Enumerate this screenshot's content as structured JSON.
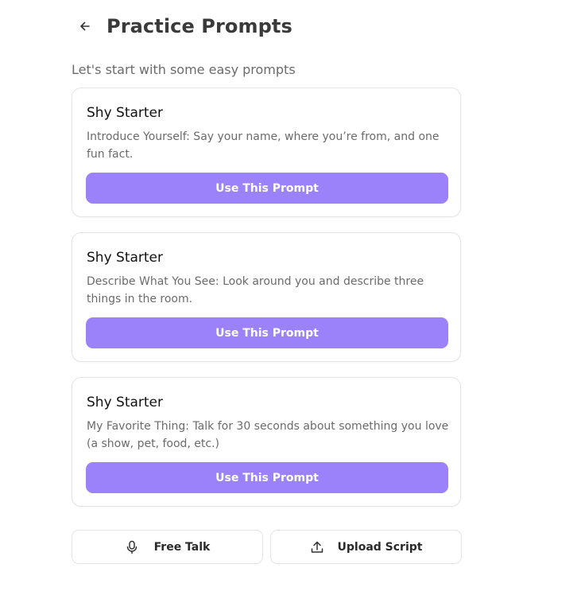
{
  "header": {
    "title": "Practice Prompts",
    "back_icon": "arrow-left-icon"
  },
  "subtitle": "Let's start with some easy prompts",
  "prompts": [
    {
      "title": "Shy Starter",
      "description": "Introduce Yourself: Say your name, where you’re from, and one fun fact.",
      "button_label": "Use This Prompt"
    },
    {
      "title": "Shy Starter",
      "description": "Describe What You See: Look around you and describe three things in the room.",
      "button_label": "Use This Prompt"
    },
    {
      "title": "Shy Starter",
      "description": "My Favorite Thing: Talk for 30 seconds about something you love (a show, pet, food, etc.)",
      "button_label": "Use This Prompt"
    }
  ],
  "actions": {
    "free_talk": {
      "label": "Free Talk",
      "icon": "microphone-icon"
    },
    "upload_script": {
      "label": "Upload Script",
      "icon": "upload-icon"
    }
  },
  "colors": {
    "accent": "#9b82fb",
    "border": "#e4e4e7",
    "title_text": "#3a3a3a",
    "muted_text": "#6b6b6b"
  }
}
